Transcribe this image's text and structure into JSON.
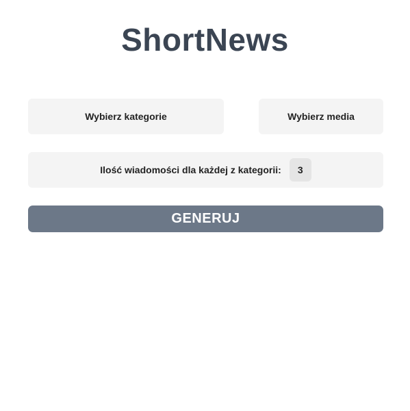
{
  "header": {
    "title": "ShortNews"
  },
  "filters": {
    "category_label": "Wybierz kategorie",
    "media_label": "Wybierz media"
  },
  "count": {
    "label": "Ilość wiadomości dla każdej z kategorii:",
    "value": "3"
  },
  "actions": {
    "generate_label": "GENERUJ"
  },
  "colors": {
    "title_text": "#3b4553",
    "panel_bg": "#f4f4f4",
    "input_bg": "#e5e5e5",
    "primary_button": "#6c7888",
    "primary_button_text": "#ffffff"
  }
}
